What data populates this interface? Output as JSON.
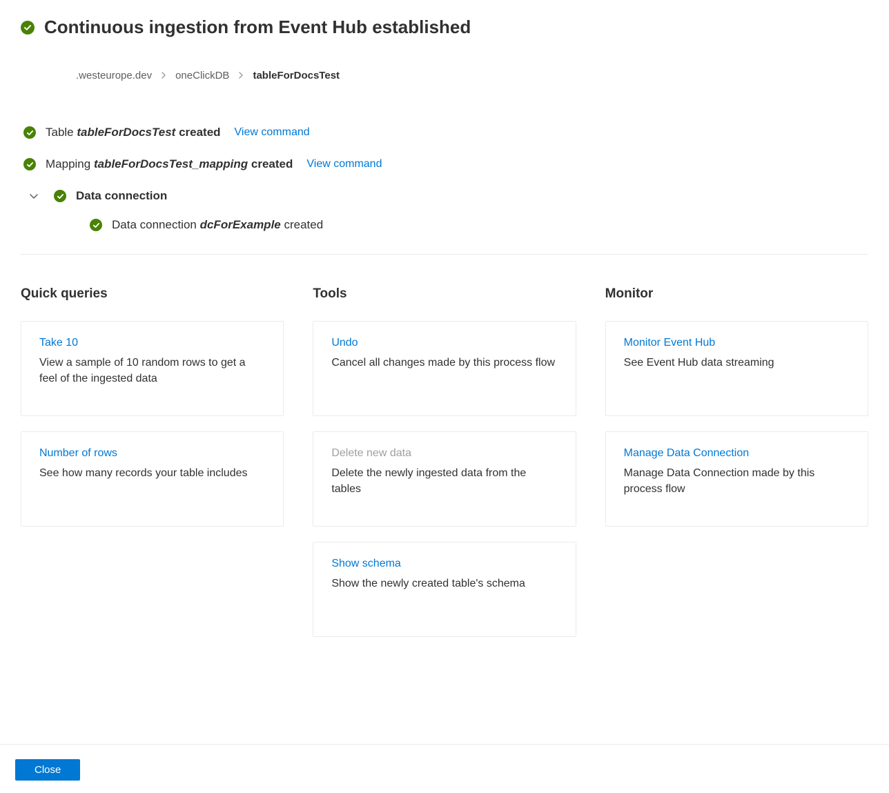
{
  "header": {
    "title": "Continuous ingestion from Event Hub established"
  },
  "breadcrumb": {
    "items": [
      {
        "label": ".westeurope.dev"
      },
      {
        "label": "oneClickDB"
      },
      {
        "label": "tableForDocsTest"
      }
    ]
  },
  "status": {
    "table": {
      "prefix": "Table ",
      "name": "tableForDocsTest",
      "suffix": " created",
      "link": "View command"
    },
    "mapping": {
      "prefix": "Mapping ",
      "name": "tableForDocsTest_mapping",
      "suffix": " created",
      "link": "View command"
    },
    "connection": {
      "label": "Data connection",
      "sub_prefix": "Data connection ",
      "sub_name": "dcForExample",
      "sub_suffix": " created"
    }
  },
  "sections": {
    "quick_queries": {
      "title": "Quick queries",
      "cards": [
        {
          "title": "Take 10",
          "desc": "View a sample of 10 random rows to get a feel of the ingested data",
          "disabled": false
        },
        {
          "title": "Number of rows",
          "desc": "See how many records your table includes",
          "disabled": false
        }
      ]
    },
    "tools": {
      "title": "Tools",
      "cards": [
        {
          "title": "Undo",
          "desc": "Cancel all changes made by this process flow",
          "disabled": false
        },
        {
          "title": "Delete new data",
          "desc": "Delete the newly ingested data from the tables",
          "disabled": true
        },
        {
          "title": "Show schema",
          "desc": "Show the newly created table's schema",
          "disabled": false
        }
      ]
    },
    "monitor": {
      "title": "Monitor",
      "cards": [
        {
          "title": "Monitor Event Hub",
          "desc": "See Event Hub data streaming",
          "disabled": false
        },
        {
          "title": "Manage Data Connection",
          "desc": "Manage Data Connection made by this process flow",
          "disabled": false
        }
      ]
    }
  },
  "footer": {
    "close": "Close"
  }
}
